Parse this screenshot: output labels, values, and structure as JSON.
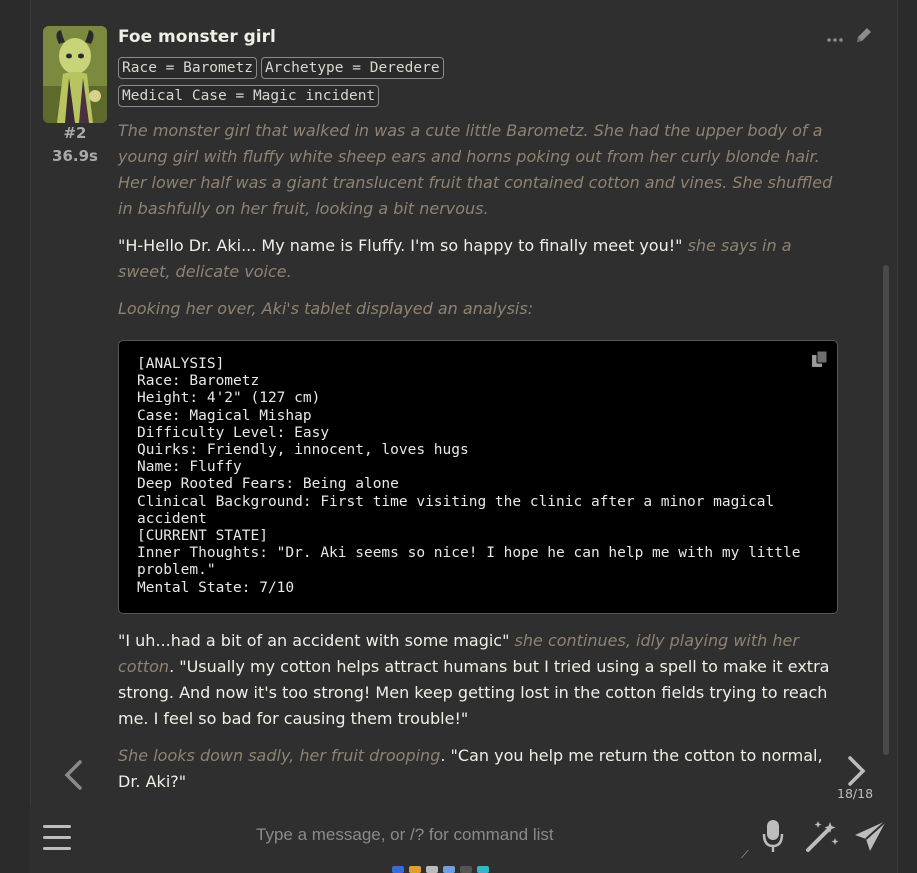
{
  "message": {
    "character_name": "Foe monster girl",
    "number": "#2",
    "time": "36.9s",
    "tags_row1": [
      "Race = Barometz",
      "Archetype = Deredere"
    ],
    "tags_row2": [
      "Medical Case = Magic incident"
    ],
    "paragraph1": "The monster girl that walked in was a cute little Barometz. She had the upper body of a young girl with fluffy white sheep ears and horns poking out from her curly blonde hair. Her lower half was a giant translucent fruit that contained cotton and vines. She shuffled in bashfully on her fruit, looking a bit nervous.",
    "paragraph2_speech": "\"H-Hello Dr. Aki... My name is Fluffy. I'm so happy to finally meet you!\"",
    "paragraph2_action": "she says in a sweet, delicate voice.",
    "paragraph3": "Looking her over, Aki's tablet displayed an analysis:",
    "analysis_block": "[ANALYSIS]\nRace: Barometz\nHeight: 4'2\" (127 cm)\nCase: Magical Mishap\nDifficulty Level: Easy\nQuirks: Friendly, innocent, loves hugs\nName: Fluffy\nDeep Rooted Fears: Being alone\nClinical Background: First time visiting the clinic after a minor magical accident\n[CURRENT STATE]\nInner Thoughts: \"Dr. Aki seems so nice! I hope he can help me with my little problem.\"\nMental State: 7/10",
    "paragraph4_speech1": "\"I uh...had a bit of an accident with some magic\"",
    "paragraph4_action": "she continues, idly playing with her cotton",
    "paragraph4_speech2": ". \"Usually my cotton helps attract humans but I tried using a spell to make it extra strong. And now it's too strong! Men keep getting lost in the cotton fields trying to reach me. I feel so bad for causing them trouble!\"",
    "paragraph5_action": "She looks down sadly, her fruit drooping",
    "paragraph5_speech": ". \"Can you help me return the cotton to normal, Dr. Aki?\"",
    "swipe_counter": "18/18"
  },
  "input": {
    "placeholder": "Type a message, or /? for command list"
  },
  "colors": {
    "background": "#2f2f2f",
    "italic_text": "#8f8272",
    "speech_text": "#efefe6",
    "code_background": "#000000"
  },
  "icons": [
    "more-icon",
    "pencil-icon",
    "copy-icon",
    "chevron-left-icon",
    "chevron-right-icon",
    "hamburger-menu-icon",
    "microphone-icon",
    "magic-wand-icon",
    "send-icon"
  ]
}
